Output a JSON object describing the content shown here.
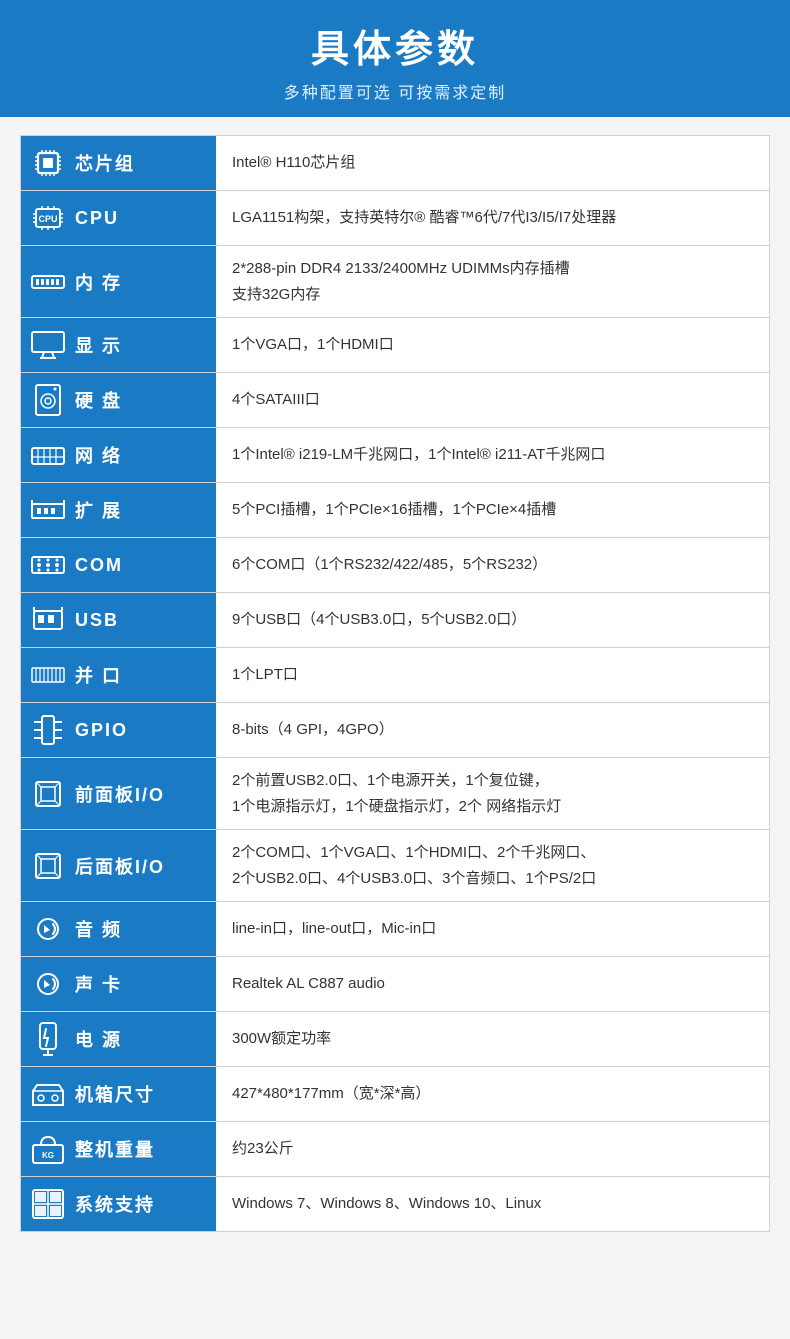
{
  "header": {
    "title": "具体参数",
    "subtitle": "多种配置可选 可按需求定制"
  },
  "rows": [
    {
      "id": "chipset",
      "icon": "🔲",
      "label": "芯片组",
      "value": [
        "Intel® H110芯片组"
      ]
    },
    {
      "id": "cpu",
      "icon": "🖥",
      "label": "CPU",
      "value": [
        "LGA1151构架，支持英特尔® 酷睿™6代/7代I3/I5/I7处理器"
      ]
    },
    {
      "id": "ram",
      "icon": "🗂",
      "label": "内 存",
      "value": [
        "2*288-pin DDR4 2133/2400MHz UDIMMs内存插槽",
        "支持32G内存"
      ]
    },
    {
      "id": "display",
      "icon": "🖥",
      "label": "显 示",
      "value": [
        "1个VGA口，1个HDMI口"
      ]
    },
    {
      "id": "hdd",
      "icon": "💾",
      "label": "硬 盘",
      "value": [
        "4个SATAIII口"
      ]
    },
    {
      "id": "network",
      "icon": "🌐",
      "label": "网 络",
      "value": [
        "1个Intel® i219-LM千兆网口，1个Intel® i211-AT千兆网口"
      ]
    },
    {
      "id": "expansion",
      "icon": "📦",
      "label": "扩 展",
      "value": [
        "5个PCI插槽，1个PCIe×16插槽，1个PCIe×4插槽"
      ]
    },
    {
      "id": "com",
      "icon": "🔌",
      "label": "COM",
      "value": [
        "6个COM口（1个RS232/422/485，5个RS232）"
      ]
    },
    {
      "id": "usb",
      "icon": "🔗",
      "label": "USB",
      "value": [
        "9个USB口（4个USB3.0口，5个USB2.0口）"
      ]
    },
    {
      "id": "parallel",
      "icon": "📋",
      "label": "并 口",
      "value": [
        "1个LPT口"
      ]
    },
    {
      "id": "gpio",
      "icon": "⬜",
      "label": "GPIO",
      "value": [
        "8-bits（4 GPI，4GPO）"
      ]
    },
    {
      "id": "frontio",
      "icon": "📁",
      "label": "前面板I/O",
      "value": [
        "2个前置USB2.0口、1个电源开关，1个复位键，",
        "1个电源指示灯，1个硬盘指示灯，2个 网络指示灯"
      ]
    },
    {
      "id": "reario",
      "icon": "📁",
      "label": "后面板I/O",
      "value": [
        "2个COM口、1个VGA口、1个HDMI口、2个千兆网口、",
        "2个USB2.0口、4个USB3.0口、3个音频口、1个PS/2口"
      ]
    },
    {
      "id": "audio",
      "icon": "🔊",
      "label": "音 频",
      "value": [
        "line-in口，line-out口，Mic-in口"
      ]
    },
    {
      "id": "soundcard",
      "icon": "🔊",
      "label": "声 卡",
      "value": [
        "Realtek AL C887 audio"
      ]
    },
    {
      "id": "power",
      "icon": "⚡",
      "label": "电 源",
      "value": [
        "300W额定功率"
      ]
    },
    {
      "id": "casesize",
      "icon": "🔧",
      "label": "机箱尺寸",
      "value": [
        "427*480*177mm（宽*深*高）"
      ]
    },
    {
      "id": "weight",
      "icon": "📦",
      "label": "整机重量",
      "value": [
        "约23公斤"
      ]
    },
    {
      "id": "os",
      "icon": "🪟",
      "label": "系统支持",
      "value": [
        "Windows 7、Windows 8、Windows 10、Linux"
      ]
    }
  ]
}
